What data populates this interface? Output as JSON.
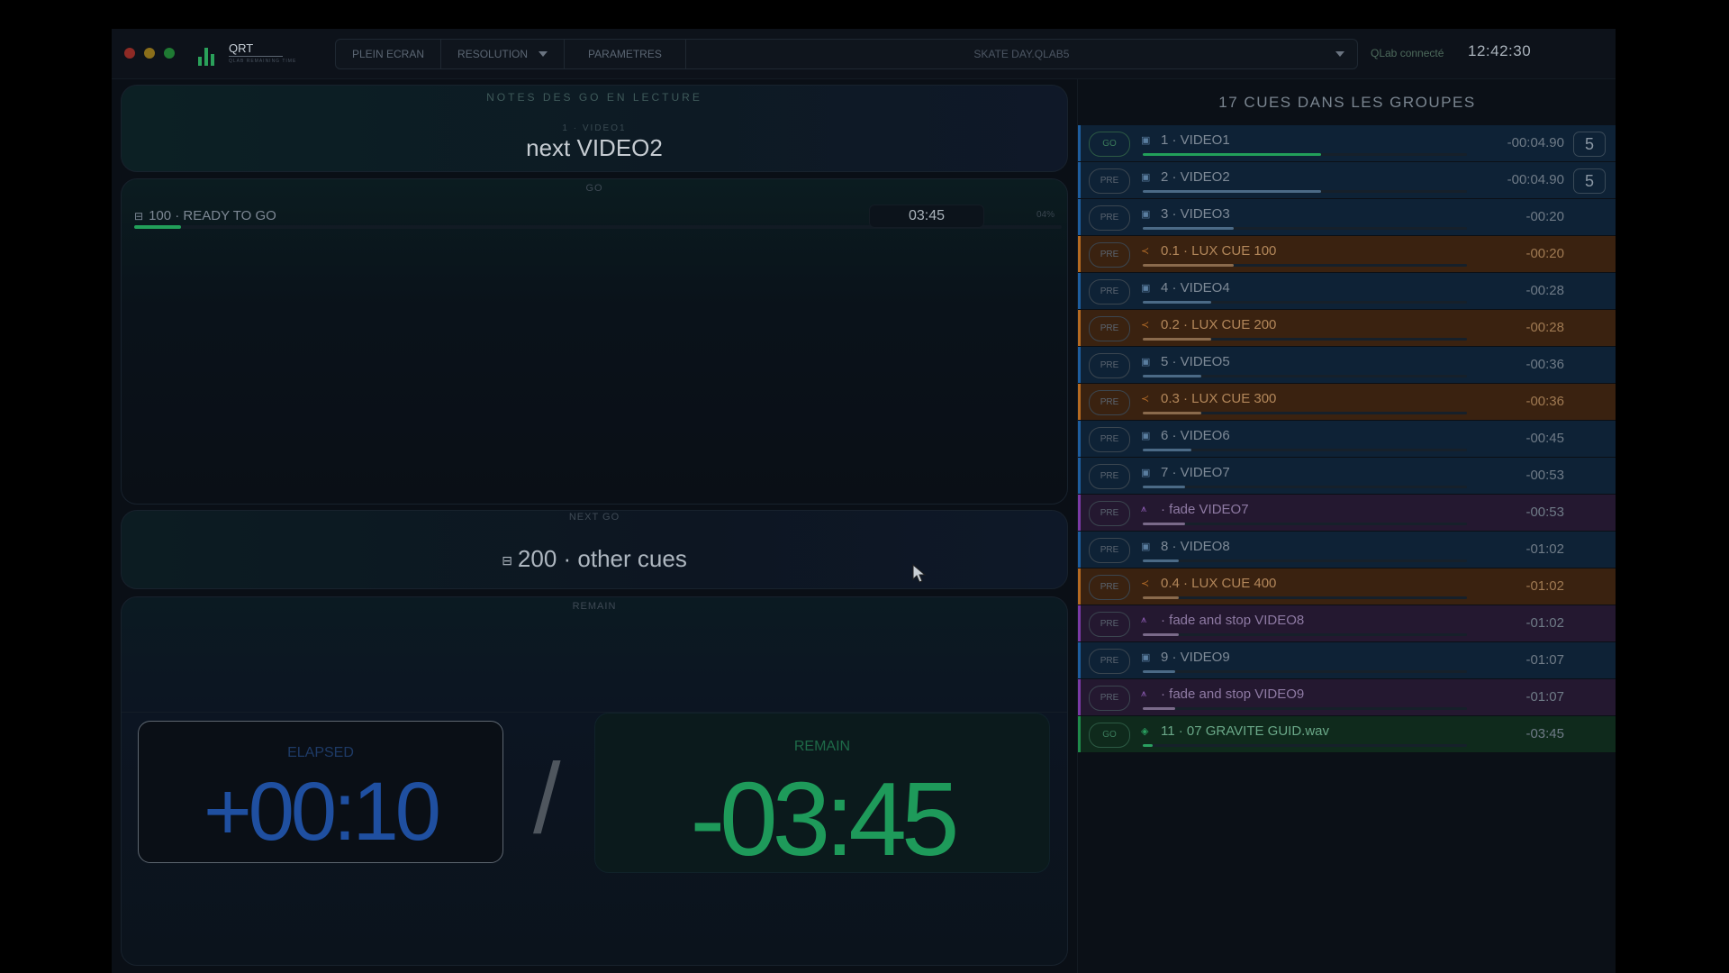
{
  "titlebar": {
    "app_name": "QRT",
    "app_subtitle": "QLAB REMAINING TIME",
    "buttons": {
      "fullscreen": "PLEIN ECRAN",
      "resolution": "RESOLUTION",
      "settings": "PARAMETRES"
    },
    "workspace_file": "SKATE DAY.QLAB5",
    "connection_status": "QLab connecté",
    "clock": "12:42:30"
  },
  "notes_panel": {
    "title": "NOTES DES GO EN LECTURE",
    "subtitle": "1 · VIDEO1",
    "note": "next VIDEO2"
  },
  "go_panel": {
    "label": "GO",
    "cue": "100 · READY TO GO",
    "time": "03:45",
    "percent": "04%",
    "progress": 0.05
  },
  "next_go_panel": {
    "label": "NEXT GO",
    "cue": "200 · other cues"
  },
  "remain_panel": {
    "label": "REMAIN",
    "elapsed_label": "ELAPSED",
    "elapsed_value": "+00:10",
    "separator": "/",
    "remain_label": "REMAIN",
    "remain_value": "-03:45"
  },
  "cues_panel": {
    "header": "17 CUES DANS LES GROUPES",
    "cues": [
      {
        "state": "GO",
        "type": "video",
        "icon": "video-icon",
        "label": "1 · VIDEO1",
        "time": "-00:04.90",
        "badge": "5",
        "progress": 0.55
      },
      {
        "state": "PRE",
        "type": "video",
        "icon": "video-icon",
        "label": "2 · VIDEO2",
        "time": "-00:04.90",
        "badge": "5",
        "progress": 0.55
      },
      {
        "state": "PRE",
        "type": "video",
        "icon": "video-icon",
        "label": "3 · VIDEO3",
        "time": "-00:20",
        "badge": "",
        "progress": 0.28
      },
      {
        "state": "PRE",
        "type": "light",
        "icon": "light-icon",
        "label": "0.1 · LUX CUE 100",
        "time": "-00:20",
        "badge": "",
        "progress": 0.28
      },
      {
        "state": "PRE",
        "type": "video",
        "icon": "video-icon",
        "label": "4 · VIDEO4",
        "time": "-00:28",
        "badge": "",
        "progress": 0.21
      },
      {
        "state": "PRE",
        "type": "light",
        "icon": "light-icon",
        "label": "0.2 · LUX CUE 200",
        "time": "-00:28",
        "badge": "",
        "progress": 0.21
      },
      {
        "state": "PRE",
        "type": "video",
        "icon": "video-icon",
        "label": "5 · VIDEO5",
        "time": "-00:36",
        "badge": "",
        "progress": 0.18
      },
      {
        "state": "PRE",
        "type": "light",
        "icon": "light-icon",
        "label": "0.3 · LUX CUE 300",
        "time": "-00:36",
        "badge": "",
        "progress": 0.18
      },
      {
        "state": "PRE",
        "type": "video",
        "icon": "video-icon",
        "label": "6 · VIDEO6",
        "time": "-00:45",
        "badge": "",
        "progress": 0.15
      },
      {
        "state": "PRE",
        "type": "video",
        "icon": "video-icon",
        "label": "7 · VIDEO7",
        "time": "-00:53",
        "badge": "",
        "progress": 0.13
      },
      {
        "state": "PRE",
        "type": "fade",
        "icon": "fade-icon",
        "label": "· fade VIDEO7",
        "time": "-00:53",
        "badge": "",
        "progress": 0.13
      },
      {
        "state": "PRE",
        "type": "video",
        "icon": "video-icon",
        "label": "8 · VIDEO8",
        "time": "-01:02",
        "badge": "",
        "progress": 0.11
      },
      {
        "state": "PRE",
        "type": "light",
        "icon": "light-icon",
        "label": "0.4 · LUX CUE 400",
        "time": "-01:02",
        "badge": "",
        "progress": 0.11
      },
      {
        "state": "PRE",
        "type": "fade",
        "icon": "fade-icon",
        "label": "· fade and stop VIDEO8",
        "time": "-01:02",
        "badge": "",
        "progress": 0.11
      },
      {
        "state": "PRE",
        "type": "video",
        "icon": "video-icon",
        "label": "9 · VIDEO9",
        "time": "-01:07",
        "badge": "",
        "progress": 0.1
      },
      {
        "state": "PRE",
        "type": "fade",
        "icon": "fade-icon",
        "label": "· fade and stop VIDEO9",
        "time": "-01:07",
        "badge": "",
        "progress": 0.1
      },
      {
        "state": "GO",
        "type": "audio",
        "icon": "audio-icon",
        "label": "11 · 07 GRAVITE GUID.wav",
        "time": "-03:45",
        "badge": "",
        "progress": 0.03
      }
    ]
  },
  "colors": {
    "elapsed": "#1f4fa0",
    "remain": "#1e9a5a",
    "video_row": "#0e2236",
    "light_row": "#3a2210",
    "fade_row": "#241830",
    "audio_row": "#0f2a1c"
  }
}
